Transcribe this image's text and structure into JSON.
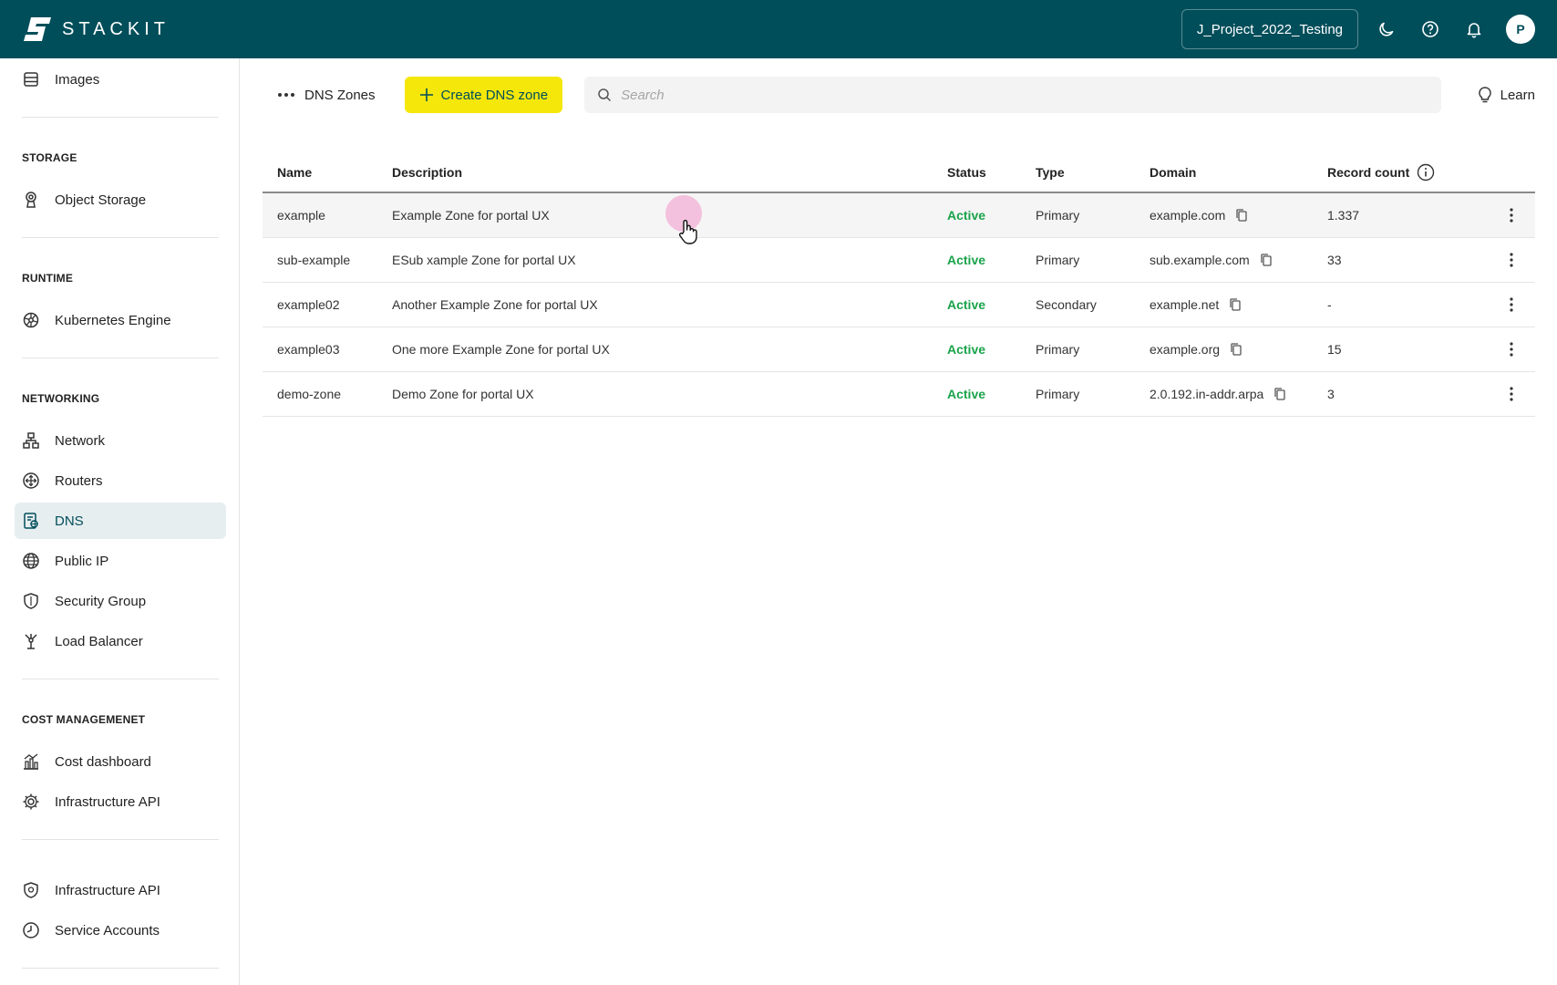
{
  "topbar": {
    "logo_text": "STACKIT",
    "project": "J_Project_2022_Testing",
    "avatar_initial": "P",
    "bg_color": "#004e5a"
  },
  "sidebar": {
    "items_top": [
      {
        "label": "Images",
        "icon": "images-icon"
      }
    ],
    "sections": [
      {
        "title": "STORAGE",
        "items": [
          {
            "label": "Object Storage",
            "icon": "object-storage-icon"
          }
        ]
      },
      {
        "title": "RUNTIME",
        "items": [
          {
            "label": "Kubernetes Engine",
            "icon": "kubernetes-icon"
          }
        ]
      },
      {
        "title": "NETWORKING",
        "items": [
          {
            "label": "Network",
            "icon": "network-icon"
          },
          {
            "label": "Routers",
            "icon": "routers-icon"
          },
          {
            "label": "DNS",
            "icon": "dns-icon",
            "active": true
          },
          {
            "label": "Public IP",
            "icon": "globe-icon"
          },
          {
            "label": "Security Group",
            "icon": "shield-icon"
          },
          {
            "label": "Load Balancer",
            "icon": "load-balancer-icon"
          }
        ]
      },
      {
        "title": "COST MANAGEMENET",
        "items": [
          {
            "label": "Cost dashboard",
            "icon": "chart-icon"
          },
          {
            "label": "Infrastructure API",
            "icon": "gear-icon"
          }
        ]
      },
      {
        "title": "",
        "items": [
          {
            "label": "Infrastructure API",
            "icon": "shield-check-icon"
          },
          {
            "label": "Service Accounts",
            "icon": "clock-icon"
          }
        ]
      }
    ],
    "active_color": "#004e5a"
  },
  "toolbar": {
    "breadcrumb": "DNS Zones",
    "create_label": "Create DNS zone",
    "search_placeholder": "Search",
    "learn_label": "Learn",
    "create_color": "#f5e70a"
  },
  "table": {
    "columns": [
      "Name",
      "Description",
      "Status",
      "Type",
      "Domain",
      "Record count"
    ],
    "rows": [
      {
        "name": "example",
        "description": "Example Zone for portal UX",
        "status": "Active",
        "type": "Primary",
        "domain": "example.com",
        "count": "1.337"
      },
      {
        "name": "sub-example",
        "description": "ESub xample Zone for portal UX",
        "status": "Active",
        "type": "Primary",
        "domain": "sub.example.com",
        "count": "33"
      },
      {
        "name": "example02",
        "description": "Another Example Zone for portal UX",
        "status": "Active",
        "type": "Secondary",
        "domain": "example.net",
        "count": "-"
      },
      {
        "name": "example03",
        "description": "One more Example Zone for portal UX",
        "status": "Active",
        "type": "Primary",
        "domain": "example.org",
        "count": "15"
      },
      {
        "name": "demo-zone",
        "description": "Demo Zone for portal UX",
        "status": "Active",
        "type": "Primary",
        "domain": "2.0.192.in-addr.arpa",
        "count": "3"
      }
    ],
    "status_color": "#1aa34a"
  }
}
